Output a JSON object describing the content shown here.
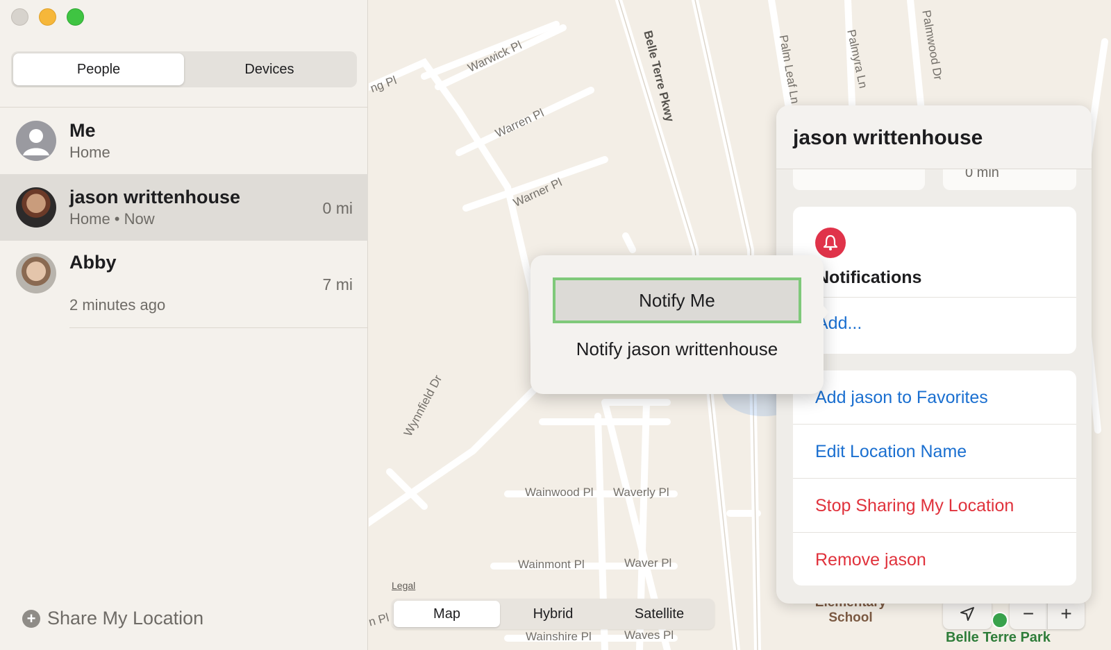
{
  "window": {
    "traffic_lights": [
      "close",
      "minimize",
      "maximize"
    ]
  },
  "sidebar": {
    "tabs": [
      {
        "label": "People",
        "active": true
      },
      {
        "label": "Devices",
        "active": false
      }
    ],
    "people": [
      {
        "name": "Me",
        "subtitle": "Home",
        "distance": ""
      },
      {
        "name": "jason writtenhouse",
        "subtitle": "Home • Now",
        "distance": "0 mi",
        "selected": true
      },
      {
        "name": "Abby",
        "subtitle": "2 minutes ago",
        "distance": "7 mi"
      }
    ],
    "share_location_label": "Share My Location"
  },
  "map": {
    "streets": [
      "ng Pl",
      "Warwick Pl",
      "Warren Pl",
      "Warner Pl",
      "Belle Terre Pkwy",
      "Palm Leaf Ln",
      "Palmyra Ln",
      "Palmwood Dr",
      "Wynnfield Dr",
      "Wainwood Pl",
      "Waverly Pl",
      "Wainmont Pl",
      "Waver Pl",
      "Wainshire Pl",
      "Waves Pl",
      "n Pl"
    ],
    "school_label": "Elementary\nSchool",
    "park_label": "Belle Terre Park",
    "legal_label": "Legal",
    "view_modes": [
      {
        "label": "Map",
        "active": true
      },
      {
        "label": "Hybrid",
        "active": false
      },
      {
        "label": "Satellite",
        "active": false
      }
    ],
    "controls": {
      "locate": "location-arrow",
      "zoom_out": "−",
      "zoom_in": "+"
    }
  },
  "detail_card": {
    "title": "jason writtenhouse",
    "stub_text": "0 min",
    "notifications": {
      "title": "Notifications",
      "add_label": "Add..."
    },
    "actions": [
      {
        "label": "Add jason to Favorites",
        "color": "#1a6fd0"
      },
      {
        "label": "Edit Location Name",
        "color": "#1a6fd0"
      },
      {
        "label": "Stop Sharing My Location",
        "color": "#e0323c"
      },
      {
        "label": "Remove jason",
        "color": "#e0323c"
      }
    ]
  },
  "popover": {
    "items": [
      {
        "label": "Notify Me",
        "focused": true
      },
      {
        "label": "Notify jason writtenhouse",
        "focused": false
      }
    ]
  },
  "colors": {
    "accent_blue": "#1a6fd0",
    "destructive_red": "#e0323c",
    "bell_red": "#e0334a",
    "focus_green": "#7fc97a"
  }
}
